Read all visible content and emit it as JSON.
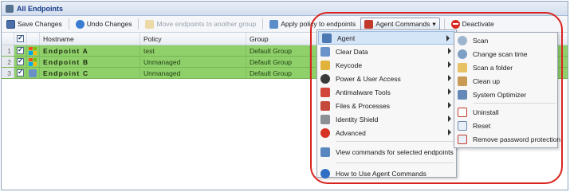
{
  "window": {
    "title": "All Endpoints"
  },
  "toolbar": {
    "save_label": "Save Changes",
    "undo_label": "Undo Changes",
    "move_label": "Move endpoints to another group",
    "apply_label": "Apply policy to endpoints",
    "agent_label": "Agent Commands",
    "deactivate_label": "Deactivate"
  },
  "grid": {
    "columns": [
      "Hostname",
      "Policy",
      "Group"
    ],
    "rows": [
      {
        "num": "1",
        "hostname": "Endpoint A",
        "policy": "test",
        "group": "Default Group"
      },
      {
        "num": "2",
        "hostname": "Endpoint B",
        "policy": "Unmanaged",
        "group": "Default Group"
      },
      {
        "num": "3",
        "hostname": "Endpoint C",
        "policy": "Unmanaged",
        "group": "Default Group"
      }
    ],
    "row_color": "#8fd06a"
  },
  "agent_menu": {
    "items": [
      {
        "label": "Agent",
        "icon": "agent-window-icon",
        "submenu": true,
        "highlighted": true
      },
      {
        "label": "Clear Data",
        "icon": "clear-data-icon",
        "submenu": true
      },
      {
        "label": "Keycode",
        "icon": "keycode-icon",
        "submenu": true
      },
      {
        "label": "Power & User Access",
        "icon": "power-plug-icon",
        "submenu": true
      },
      {
        "label": "Antimalware Tools",
        "icon": "antimalware-tools-icon",
        "submenu": true
      },
      {
        "label": "Files & Processes",
        "icon": "files-processes-icon",
        "submenu": true
      },
      {
        "label": "Identity Shield",
        "icon": "identity-shield-icon",
        "submenu": true
      },
      {
        "label": "Advanced",
        "icon": "advanced-icon",
        "submenu": true
      },
      {
        "label": "View commands for selected endpoints",
        "icon": "view-commands-icon",
        "submenu": false
      },
      {
        "label": "How to Use Agent Commands",
        "icon": "help-icon",
        "submenu": false
      }
    ]
  },
  "agent_submenu": {
    "items": [
      {
        "label": "Scan",
        "icon": "magnifier-icon"
      },
      {
        "label": "Change scan time",
        "icon": "clock-icon"
      },
      {
        "label": "Scan a folder",
        "icon": "folder-scan-icon"
      },
      {
        "label": "Clean up",
        "icon": "broom-icon"
      },
      {
        "label": "System Optimizer",
        "icon": "system-optimizer-icon"
      },
      {
        "label": "Uninstall",
        "icon": "uninstall-icon"
      },
      {
        "label": "Reset",
        "icon": "reset-icon"
      },
      {
        "label": "Remove password protection",
        "icon": "remove-password-icon"
      }
    ]
  },
  "highlight_color": "#d9231f"
}
